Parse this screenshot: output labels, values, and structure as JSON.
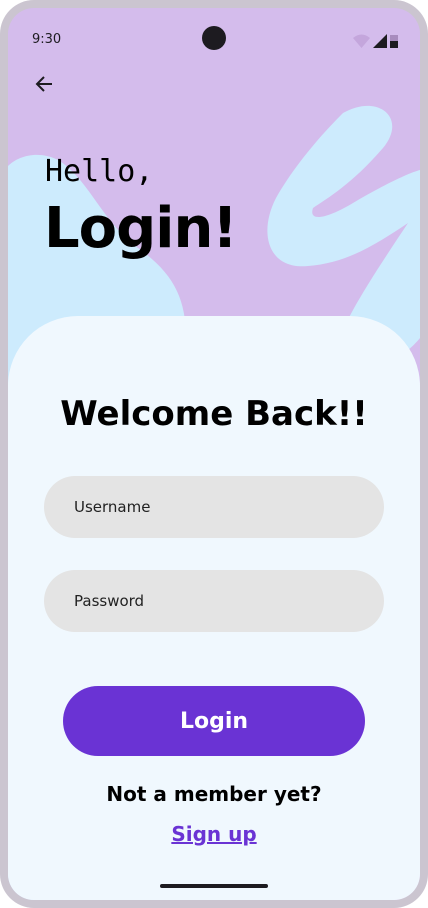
{
  "status_bar": {
    "time": "9:30"
  },
  "header": {
    "greeting": "Hello,",
    "title": "Login!"
  },
  "card": {
    "heading": "Welcome Back!!",
    "username_placeholder": "Username",
    "password_placeholder": "Password",
    "login_label": "Login",
    "prompt": "Not a member yet?",
    "signup_label": "Sign up"
  },
  "colors": {
    "background": "#d4bcec",
    "blob": "#cdebfd",
    "card": "#f0f8fe",
    "accent": "#6a33d4",
    "field": "#e4e4e4"
  }
}
